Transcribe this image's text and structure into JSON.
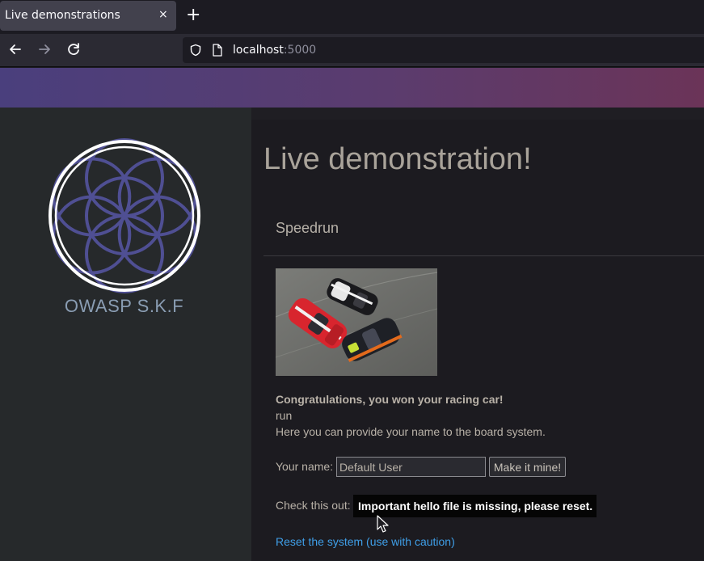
{
  "browser": {
    "tab_title": "Live demonstrations",
    "tab_close": "×",
    "new_tab": "+",
    "url_host": "localhost",
    "url_port": ":5000"
  },
  "sidebar": {
    "logo_text": "OWASP S.K.F",
    "logo_colors": {
      "ring": "#ffffff",
      "petals": "#4f4f93"
    }
  },
  "main": {
    "page_title": "Live demonstration!",
    "section_title": "Speedrun",
    "congrats": "Congratulations, you won your racing car!",
    "run_text": "run",
    "provide_text": "Here you can provide your name to the board system.",
    "name_label": "Your name:",
    "name_value": "Default User",
    "make_button": "Make it mine!",
    "check_label": "Check this out:",
    "message": "Important hello file is missing, please reset.",
    "reset_link": "Reset the system (use with caution)"
  },
  "colors": {
    "banner_start": "#4a3f7d",
    "banner_end": "#6b3458",
    "link": "#3f9fe8"
  }
}
